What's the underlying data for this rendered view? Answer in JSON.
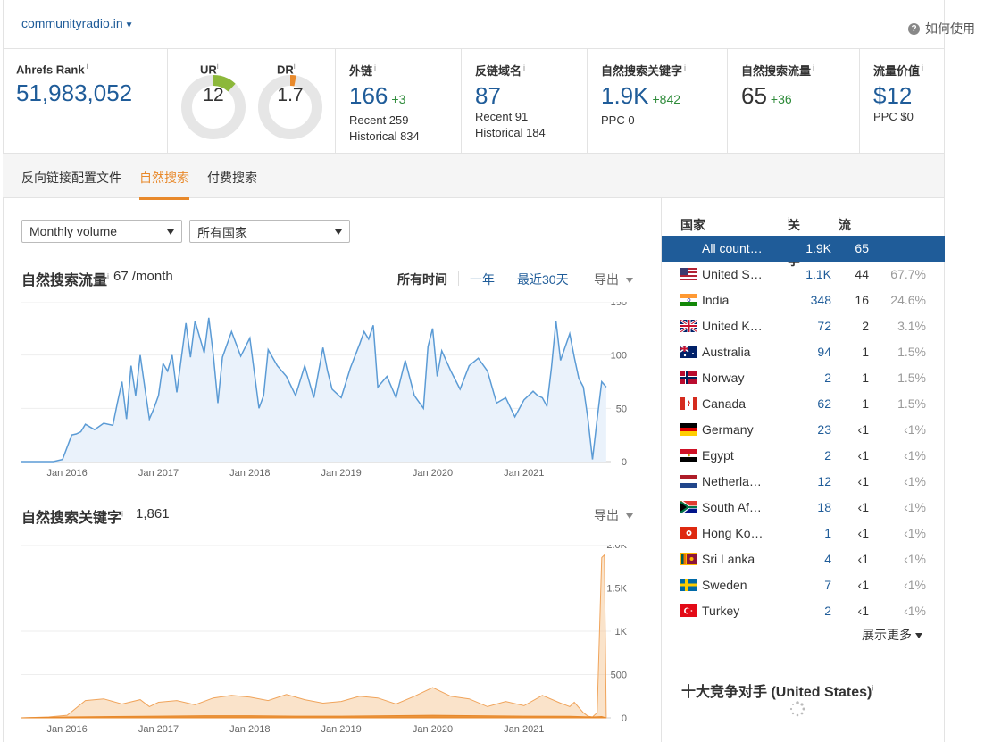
{
  "header": {
    "domain": "communityradio.in",
    "help": "如何使用"
  },
  "metrics": {
    "ahrefs_rank": {
      "label": "Ahrefs Rank",
      "value": "51,983,052"
    },
    "ur": {
      "label": "UR",
      "value": "12",
      "fill": 0.12,
      "color": "#8cb83a"
    },
    "dr": {
      "label": "DR",
      "value": "1.7",
      "fill": 0.017,
      "color": "#e8892b"
    },
    "backlinks": {
      "label": "外链",
      "value": "166",
      "delta": "+3",
      "recent": "Recent 259",
      "historical": "Historical 834"
    },
    "ref_domains": {
      "label": "反链域名",
      "value": "87",
      "recent": "Recent 91",
      "historical": "Historical 184"
    },
    "organic_keywords": {
      "label": "自然搜索关键字",
      "value": "1.9K",
      "delta": "+842",
      "ppc": "PPC 0"
    },
    "organic_traffic": {
      "label": "自然搜索流量",
      "value": "65",
      "delta": "+36"
    },
    "traffic_value": {
      "label": "流量价值",
      "value": "$12",
      "ppc": "PPC $0"
    }
  },
  "tabs": [
    {
      "label": "反向链接配置文件"
    },
    {
      "label": "自然搜索"
    },
    {
      "label": "付费搜索"
    }
  ],
  "filters": {
    "volume": "Monthly volume",
    "country": "所有国家"
  },
  "traffic_section": {
    "title": "自然搜索流量",
    "value": "67 /month",
    "ranges": [
      "所有时间",
      "一年",
      "最近30天"
    ],
    "export": "导出"
  },
  "keywords_section": {
    "title": "自然搜索关键字",
    "value": "1,861",
    "export": "导出"
  },
  "countries": {
    "headers": {
      "country": "国家",
      "keywords": "关键字",
      "traffic": "流量"
    },
    "rows": [
      {
        "name": "All count…",
        "kw": "1.9K",
        "traffic": "65",
        "pct": "",
        "flag": "none",
        "selected": true
      },
      {
        "name": "United S…",
        "kw": "1.1K",
        "traffic": "44",
        "pct": "67.7%",
        "flag": "us"
      },
      {
        "name": "India",
        "kw": "348",
        "traffic": "16",
        "pct": "24.6%",
        "flag": "in"
      },
      {
        "name": "United K…",
        "kw": "72",
        "traffic": "2",
        "pct": "3.1%",
        "flag": "gb"
      },
      {
        "name": "Australia",
        "kw": "94",
        "traffic": "1",
        "pct": "1.5%",
        "flag": "au"
      },
      {
        "name": "Norway",
        "kw": "2",
        "traffic": "1",
        "pct": "1.5%",
        "flag": "no"
      },
      {
        "name": "Canada",
        "kw": "62",
        "traffic": "1",
        "pct": "1.5%",
        "flag": "ca"
      },
      {
        "name": "Germany",
        "kw": "23",
        "traffic": "‹1",
        "pct": "‹1%",
        "flag": "de"
      },
      {
        "name": "Egypt",
        "kw": "2",
        "traffic": "‹1",
        "pct": "‹1%",
        "flag": "eg"
      },
      {
        "name": "Netherla…",
        "kw": "12",
        "traffic": "‹1",
        "pct": "‹1%",
        "flag": "nl"
      },
      {
        "name": "South Af…",
        "kw": "18",
        "traffic": "‹1",
        "pct": "‹1%",
        "flag": "za"
      },
      {
        "name": "Hong Ko…",
        "kw": "1",
        "traffic": "‹1",
        "pct": "‹1%",
        "flag": "hk"
      },
      {
        "name": "Sri Lanka",
        "kw": "4",
        "traffic": "‹1",
        "pct": "‹1%",
        "flag": "lk"
      },
      {
        "name": "Sweden",
        "kw": "7",
        "traffic": "‹1",
        "pct": "‹1%",
        "flag": "se"
      },
      {
        "name": "Turkey",
        "kw": "2",
        "traffic": "‹1",
        "pct": "‹1%",
        "flag": "tr"
      }
    ],
    "show_more": "展示更多"
  },
  "competitors": {
    "title": "十大竞争对手 (United States)"
  },
  "chart_data": [
    {
      "type": "line",
      "title": "自然搜索流量",
      "x_ticks": [
        "Jan 2016",
        "Jan 2017",
        "Jan 2018",
        "Jan 2019",
        "Jan 2020",
        "Jan 2021"
      ],
      "y_ticks": [
        "150",
        "100",
        "50",
        "0"
      ],
      "ylim": [
        0,
        150
      ],
      "xlim": [
        2015.5,
        2021.95
      ],
      "color": "#5b9bd5",
      "series": [
        {
          "x": [
            2015.5,
            2015.7,
            2015.85,
            2015.95,
            2016.05,
            2016.1,
            2016.15,
            2016.2,
            2016.3,
            2016.4,
            2016.5,
            2016.55,
            2016.6,
            2016.65,
            2016.7,
            2016.75,
            2016.8,
            2016.85,
            2016.9,
            2016.95,
            2017.0,
            2017.05,
            2017.1,
            2017.15,
            2017.2,
            2017.3,
            2017.35,
            2017.4,
            2017.5,
            2017.55,
            2017.6,
            2017.65,
            2017.7,
            2017.8,
            2017.9,
            2018.0,
            2018.1,
            2018.15,
            2018.2,
            2018.3,
            2018.4,
            2018.5,
            2018.6,
            2018.7,
            2018.8,
            2018.85,
            2018.9,
            2019.0,
            2019.1,
            2019.2,
            2019.25,
            2019.3,
            2019.35,
            2019.4,
            2019.5,
            2019.6,
            2019.7,
            2019.8,
            2019.9,
            2019.95,
            2020.0,
            2020.05,
            2020.1,
            2020.2,
            2020.3,
            2020.4,
            2020.5,
            2020.6,
            2020.7,
            2020.8,
            2020.9,
            2021.0,
            2021.1,
            2021.15,
            2021.2,
            2021.25,
            2021.3,
            2021.35,
            2021.4,
            2021.5,
            2021.55,
            2021.6,
            2021.65,
            2021.7,
            2021.75,
            2021.8,
            2021.85,
            2021.9
          ],
          "y": [
            0,
            0,
            0,
            2,
            25,
            26,
            28,
            35,
            30,
            36,
            34,
            55,
            75,
            40,
            90,
            62,
            100,
            70,
            40,
            50,
            62,
            92,
            85,
            100,
            65,
            130,
            98,
            132,
            102,
            135,
            100,
            55,
            98,
            122,
            99,
            116,
            50,
            62,
            105,
            90,
            80,
            62,
            90,
            60,
            107,
            85,
            68,
            60,
            88,
            110,
            122,
            115,
            128,
            70,
            80,
            60,
            95,
            62,
            50,
            108,
            125,
            80,
            104,
            85,
            68,
            90,
            97,
            85,
            55,
            60,
            42,
            58,
            66,
            62,
            60,
            52,
            88,
            132,
            95,
            120,
            98,
            78,
            70,
            40,
            2,
            40,
            75,
            70
          ]
        }
      ]
    },
    {
      "type": "area",
      "title": "自然搜索关键字",
      "x_ticks": [
        "Jan 2016",
        "Jan 2017",
        "Jan 2018",
        "Jan 2019",
        "Jan 2020",
        "Jan 2021"
      ],
      "y_ticks": [
        "2.0K",
        "1.5K",
        "1K",
        "500",
        "0"
      ],
      "ylim": [
        0,
        2000
      ],
      "xlim": [
        2015.5,
        2021.95
      ],
      "series": [
        {
          "name": "",
          "color": "#f5c08a",
          "x": [
            2015.5,
            2015.8,
            2016.0,
            2016.2,
            2016.4,
            2016.6,
            2016.8,
            2016.9,
            2017.0,
            2017.2,
            2017.4,
            2017.6,
            2017.8,
            2018.0,
            2018.2,
            2018.4,
            2018.6,
            2018.8,
            2019.0,
            2019.2,
            2019.4,
            2019.6,
            2019.8,
            2020.0,
            2020.2,
            2020.4,
            2020.6,
            2020.8,
            2021.0,
            2021.2,
            2021.4,
            2021.5,
            2021.55,
            2021.6,
            2021.65,
            2021.7,
            2021.75,
            2021.8,
            2021.85,
            2021.88,
            2021.9
          ],
          "y": [
            0,
            10,
            30,
            200,
            220,
            160,
            210,
            130,
            180,
            200,
            150,
            230,
            260,
            240,
            200,
            270,
            210,
            170,
            190,
            250,
            230,
            160,
            250,
            350,
            250,
            220,
            130,
            190,
            140,
            260,
            170,
            130,
            180,
            120,
            60,
            20,
            10,
            60,
            1850,
            1880,
            0
          ]
        },
        {
          "name": "",
          "color": "#e8892b",
          "x": [
            2015.5,
            2016.0,
            2016.5,
            2017.0,
            2017.5,
            2018.0,
            2018.5,
            2019.0,
            2019.5,
            2020.0,
            2020.5,
            2021.0,
            2021.5,
            2021.75,
            2021.85,
            2021.9
          ],
          "y": [
            0,
            10,
            15,
            20,
            25,
            25,
            20,
            20,
            25,
            30,
            25,
            20,
            18,
            10,
            15,
            0
          ]
        }
      ]
    }
  ]
}
